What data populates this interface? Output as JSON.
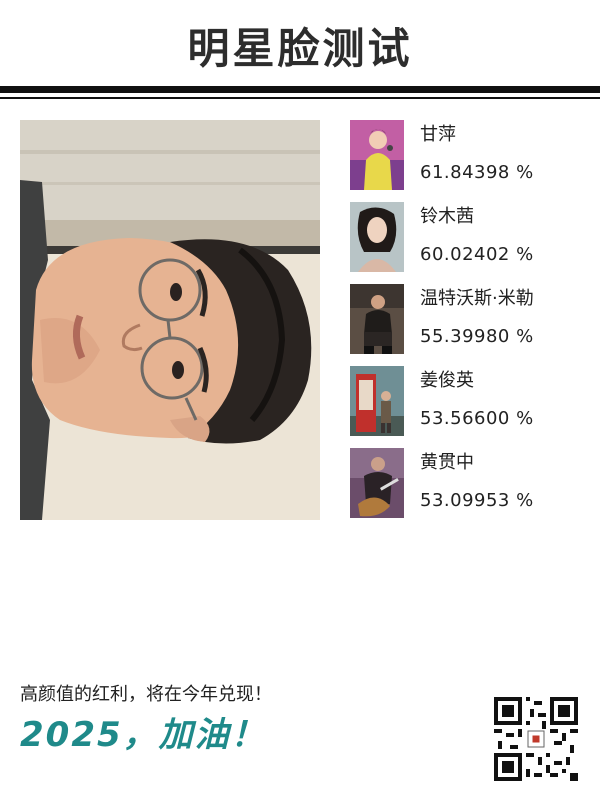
{
  "header": {
    "title": "明星脸测试"
  },
  "results": [
    {
      "name": "甘萍",
      "score": "61.84398 %",
      "thumb_icon": "singer-thumbnail"
    },
    {
      "name": "铃木茜",
      "score": "60.02402 %",
      "thumb_icon": "portrait-thumbnail"
    },
    {
      "name": "温特沃斯·米勒",
      "score": "55.39980 %",
      "thumb_icon": "seated-man-thumbnail"
    },
    {
      "name": "姜俊英",
      "score": "53.56600 %",
      "thumb_icon": "phone-booth-thumbnail"
    },
    {
      "name": "黄贯中",
      "score": "53.09953 %",
      "thumb_icon": "guitarist-thumbnail"
    }
  ],
  "footer": {
    "tagline": "高颜值的红利，将在今年兑现！",
    "slogan": "2025，加油！"
  },
  "colors": {
    "accent": "#1f8a8a",
    "title": "#2d2d2d",
    "rule": "#111111"
  },
  "icons": {
    "photo": "user-face-photo",
    "qr": "qr-code"
  }
}
